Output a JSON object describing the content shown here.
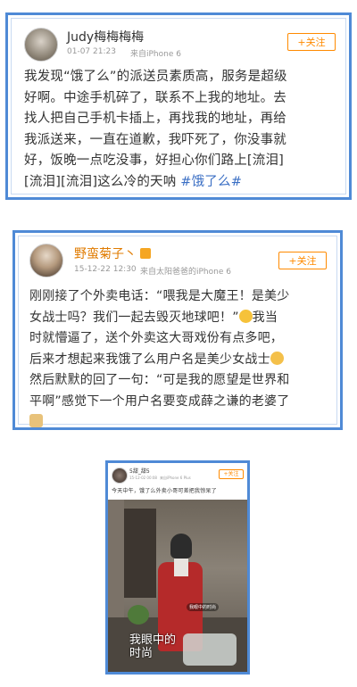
{
  "posts": [
    {
      "username": "Judy梅梅梅梅",
      "time": "01-07 21:23",
      "source": "来自iPhone 6",
      "follow_label": "+关注",
      "lines": [
        "我发现“饿了么”的派送员素质高，服务是超级",
        "好啊。中途手机碎了，联系不上我的地址。去",
        "找人把自己手机卡插上，再找我的地址，再给",
        "我派送来，一直在道歉，我吓死了，你没事就",
        "好，饭晚一点吃没事，好担心你们路上[流泪]"
      ],
      "last_line_text": "[流泪][流泪]这么冷的天呐 ",
      "hashtag": "#饿了么#"
    },
    {
      "username": "野蛮菊子丶",
      "time": "15-12-22 12:30",
      "source": "来自太阳爸爸的iPhone 6",
      "follow_label": "+关注",
      "lines": [
        "刚刚接了个外卖电话：“喂我是大魔王！是美少",
        "女战士吗？我们一起去毁灭地球吧！”",
        "时就懵逼了，送个外卖这大哥戏份有点多吧，",
        "后来才想起来我饿了么用户名是美少女战士",
        "然后默默的回了一句：“可是我的愿望是世界和",
        "平啊”感觉下一个用户名要变成薛之谦的老婆了"
      ],
      "line2_tail": "我当"
    },
    {
      "username": "5甜_甜5",
      "time": "15-12-02 00:08",
      "source": "来自iPhone 6 Plus",
      "follow_label": "+关注",
      "text": "今天中午，饿了么外卖小哥可差把我惊呆了",
      "photo_caption": "我眼中的时尚",
      "photo_tag": "我眼中的时尚"
    }
  ]
}
